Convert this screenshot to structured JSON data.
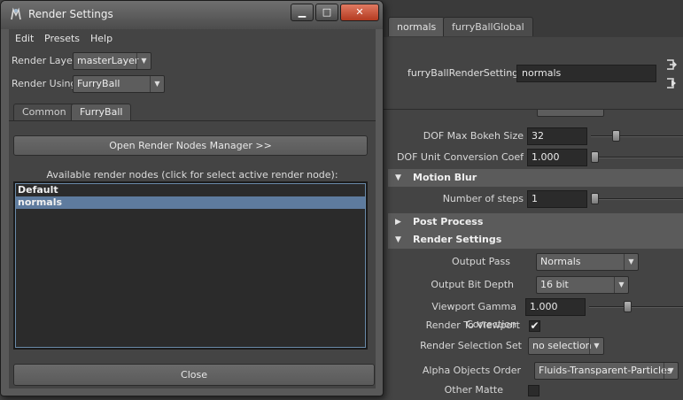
{
  "attribute_editor": {
    "tabs": [
      {
        "label": "normals"
      },
      {
        "label": "furryBallGlobal"
      }
    ],
    "node_label": "furryBallRenderSettings:",
    "node_value": "normals",
    "dof": {
      "max_bokeh_label": "DOF Max Bokeh Size",
      "max_bokeh_value": "32",
      "max_bokeh_slider": 0.25,
      "unit_conv_label": "DOF Unit Conversion Coef",
      "unit_conv_value": "1.000",
      "unit_conv_slider": 0.0
    },
    "motion_blur": {
      "section_label": "Motion Blur",
      "steps_label": "Number of steps",
      "steps_value": "1",
      "steps_slider": 0.0
    },
    "post_process": {
      "section_label": "Post Process"
    },
    "render_settings": {
      "section_label": "Render Settings",
      "output_pass_label": "Output Pass",
      "output_pass_value": "Normals",
      "bit_depth_label": "Output Bit Depth",
      "bit_depth_value": "16 bit",
      "gamma_label": "Viewport Gamma Correction",
      "gamma_value": "1.000",
      "gamma_slider": 0.4,
      "render_to_viewport_label": "Render To Viewport",
      "render_to_viewport_checked": true,
      "selection_set_label": "Render Selection Set",
      "selection_set_value": "no selection",
      "alpha_order_label": "Alpha Objects Order",
      "alpha_order_value": "Fluids-Transparent-Particles",
      "other_matte_label": "Other Matte",
      "other_matte_checked": false
    }
  },
  "render_window": {
    "title": "Render Settings",
    "buttons": {
      "minimize": "▁",
      "maximize": "□",
      "close": "✕"
    },
    "menu": [
      "Edit",
      "Presets",
      "Help"
    ],
    "render_layer_label": "Render Layer",
    "render_layer_value": "masterLayer",
    "render_using_label": "Render Using",
    "render_using_value": "FurryBall",
    "tabs": [
      {
        "label": "Common",
        "active": false
      },
      {
        "label": "FurryBall",
        "active": true
      }
    ],
    "open_manager_button": "Open Render Nodes Manager >>",
    "available_label": "Available render nodes (click for select active render node):",
    "nodes": [
      {
        "label": "Default",
        "selected": false
      },
      {
        "label": "normals",
        "selected": true
      }
    ],
    "close_button": "Close"
  },
  "icons": {
    "dropdown_arrow": "▼",
    "section_expanded": "▼",
    "section_collapsed": "▶",
    "check": "✔"
  },
  "colors": {
    "selection": "#5e7b9e",
    "close_button": "#c8502f"
  }
}
